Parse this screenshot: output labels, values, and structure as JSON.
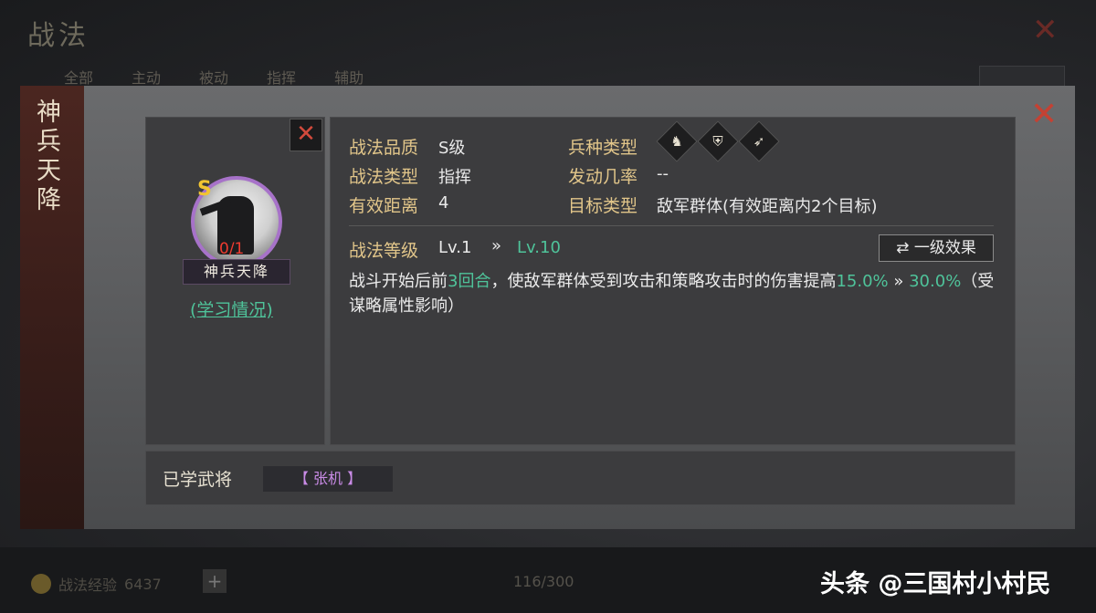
{
  "background": {
    "title": "战法",
    "tabs": [
      "全部",
      "主动",
      "被动",
      "指挥",
      "辅助"
    ],
    "exp_label": "战法经验",
    "exp_value": "6437",
    "slot_count": "116/300"
  },
  "modal": {
    "side_title": "神兵天降",
    "close_icon": "close-icon",
    "tactic": {
      "grade": "S",
      "progress": "0/1",
      "name": "神兵天降",
      "study_link": "(学习情况)"
    },
    "info": {
      "quality_label": "战法品质",
      "quality_value": "S级",
      "type_label": "战法类型",
      "type_value": "指挥",
      "range_label": "有效距离",
      "range_value": "4",
      "troop_label": "兵种类型",
      "troop_icons": [
        "cavalry-icon",
        "shield-icon",
        "bow-icon"
      ],
      "rate_label": "发动几率",
      "rate_value": "--",
      "target_label": "目标类型",
      "target_value": "敌军群体(有效距离内2个目标)"
    },
    "level": {
      "label": "战法等级",
      "current": "Lv.1",
      "arrow": "»",
      "max": "Lv.10",
      "effect_button": "⇄ 一级效果"
    },
    "description": {
      "p1": "战斗开始后前",
      "rounds": "3回合",
      "p2": "，使敌军群体受到攻击和策略攻击时的伤害提高",
      "v1": "15.0%",
      "arrow": " » ",
      "v2": "30.0%",
      "p3": "（受谋略属性影响）"
    },
    "learned": {
      "label": "已学武将",
      "general": "【 张机 】"
    }
  },
  "watermark": "头条 @三国村小村民"
}
